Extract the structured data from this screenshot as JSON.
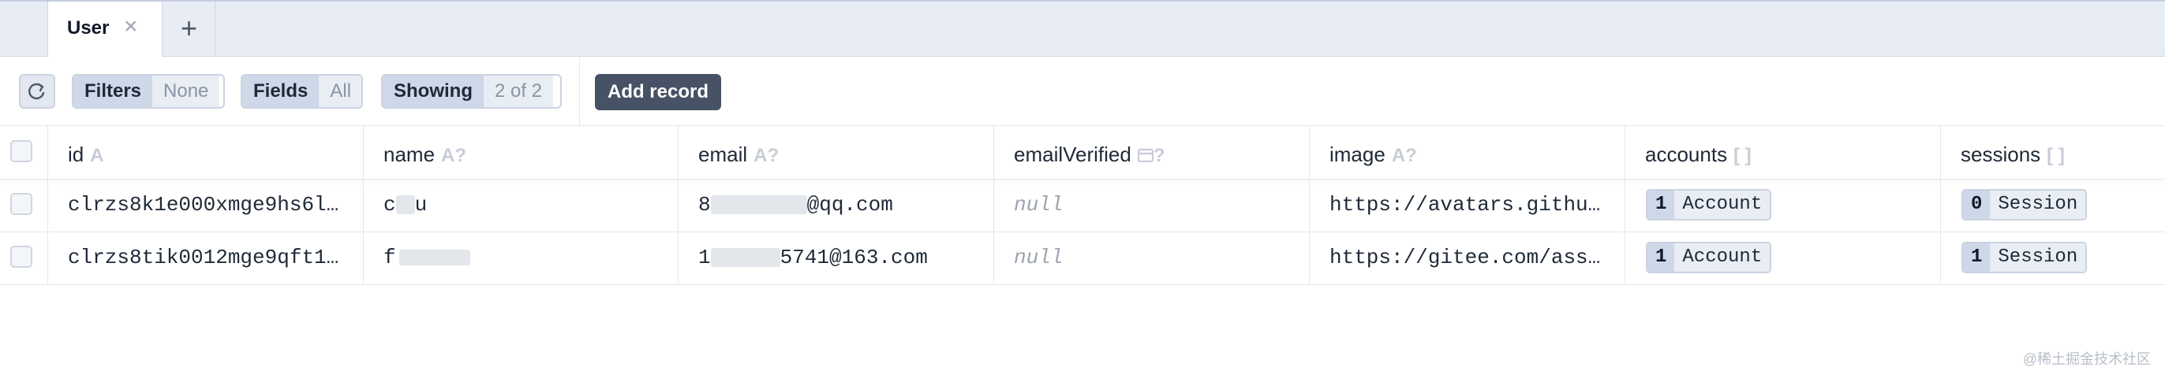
{
  "tabs": {
    "active_label": "User",
    "close_glyph": "×",
    "add_glyph": "+"
  },
  "toolbar": {
    "refresh_icon": "refresh-icon",
    "filters_label": "Filters",
    "filters_value": "None",
    "fields_label": "Fields",
    "fields_value": "All",
    "showing_label": "Showing",
    "showing_value": "2 of 2",
    "add_record_label": "Add record"
  },
  "columns": [
    {
      "name": "id",
      "type": "A"
    },
    {
      "name": "name",
      "type": "A?"
    },
    {
      "name": "email",
      "type": "A?"
    },
    {
      "name": "emailVerified",
      "type": "?"
    },
    {
      "name": "image",
      "type": "A?"
    },
    {
      "name": "accounts",
      "type": "[ ]"
    },
    {
      "name": "sessions",
      "type": "[ ]"
    }
  ],
  "rows": [
    {
      "id": "clrzs8k1e000xmge9hs6l…",
      "name": "c",
      "name_tail": "u",
      "email_prefix": "8",
      "email_suffix": "@qq.com",
      "emailVerified": "null",
      "image": "https://avatars.githu…",
      "accounts_count": "1",
      "accounts_label": "Account",
      "sessions_count": "0",
      "sessions_label": "Session"
    },
    {
      "id": "clrzs8tik0012mge9qft1…",
      "name": "f",
      "name_tail": "",
      "email_prefix": "1",
      "email_suffix": "5741@163.com",
      "emailVerified": "null",
      "image": "https://gitee.com/ass…",
      "accounts_count": "1",
      "accounts_label": "Account",
      "sessions_count": "1",
      "sessions_label": "Session"
    }
  ],
  "watermark": "@稀土掘金技术社区",
  "colors": {
    "accent_button": "#475266",
    "tab_bar": "#e8ecf5",
    "chip": "#cfd8e8"
  }
}
